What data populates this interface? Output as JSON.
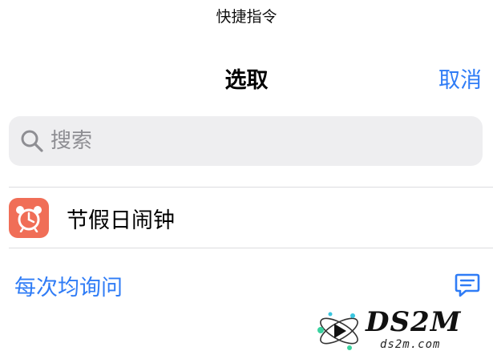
{
  "app": {
    "title": "快捷指令"
  },
  "nav": {
    "title": "选取",
    "cancel_label": "取消"
  },
  "search": {
    "placeholder": "搜索",
    "value": ""
  },
  "list": {
    "items": [
      {
        "label": "节假日闹钟",
        "icon": "alarm-clock-icon",
        "icon_color": "#f06e57"
      }
    ]
  },
  "footer": {
    "ask_label": "每次均询问",
    "icon": "comment-icon"
  },
  "watermark": {
    "logo": "DS2M",
    "sub": "ds2m.com"
  },
  "colors": {
    "accent": "#2f7cf6",
    "search_bg": "#eeeef0"
  }
}
